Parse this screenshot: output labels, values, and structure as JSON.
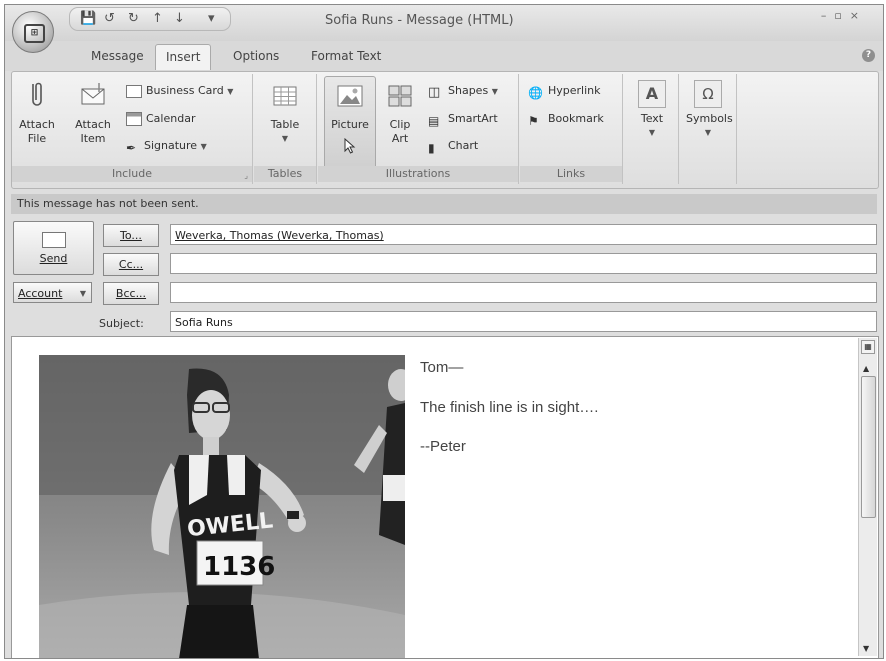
{
  "window": {
    "title": "Sofia Runs - Message (HTML)"
  },
  "tabs": [
    {
      "label": "Message"
    },
    {
      "label": "Insert"
    },
    {
      "label": "Options"
    },
    {
      "label": "Format Text"
    }
  ],
  "ribbon": {
    "include": {
      "label": "Include",
      "attach_file": "Attach File",
      "attach_item": "Attach Item",
      "business_card": "Business Card",
      "calendar": "Calendar",
      "signature": "Signature"
    },
    "tables": {
      "label": "Tables",
      "table": "Table"
    },
    "illustrations": {
      "label": "Illustrations",
      "picture": "Picture",
      "clip_art": "Clip Art",
      "shapes": "Shapes",
      "smartart": "SmartArt",
      "chart": "Chart"
    },
    "links": {
      "label": "Links",
      "hyperlink": "Hyperlink",
      "bookmark": "Bookmark"
    },
    "text": {
      "label": "Text"
    },
    "symbols": {
      "label": "Symbols"
    }
  },
  "message": {
    "notice": "This message has not been sent.",
    "send_label": "Send",
    "account_label": "Account",
    "to_button": "To...",
    "cc_button": "Cc...",
    "bcc_button": "Bcc...",
    "to_value": "Weverka, Thomas (Weverka, Thomas)",
    "cc_value": "",
    "bcc_value": "",
    "subject_label": "Subject:",
    "subject_value": "Sofia Runs"
  },
  "body": {
    "greeting": "Tom—",
    "line": "The finish line is in sight….",
    "signoff": "--Peter",
    "bib_number": "1136",
    "jersey_text": "OWELL"
  },
  "colors": {
    "ribbon_bg": "#e6e6e6",
    "notice_bg": "#c9c9c9"
  }
}
